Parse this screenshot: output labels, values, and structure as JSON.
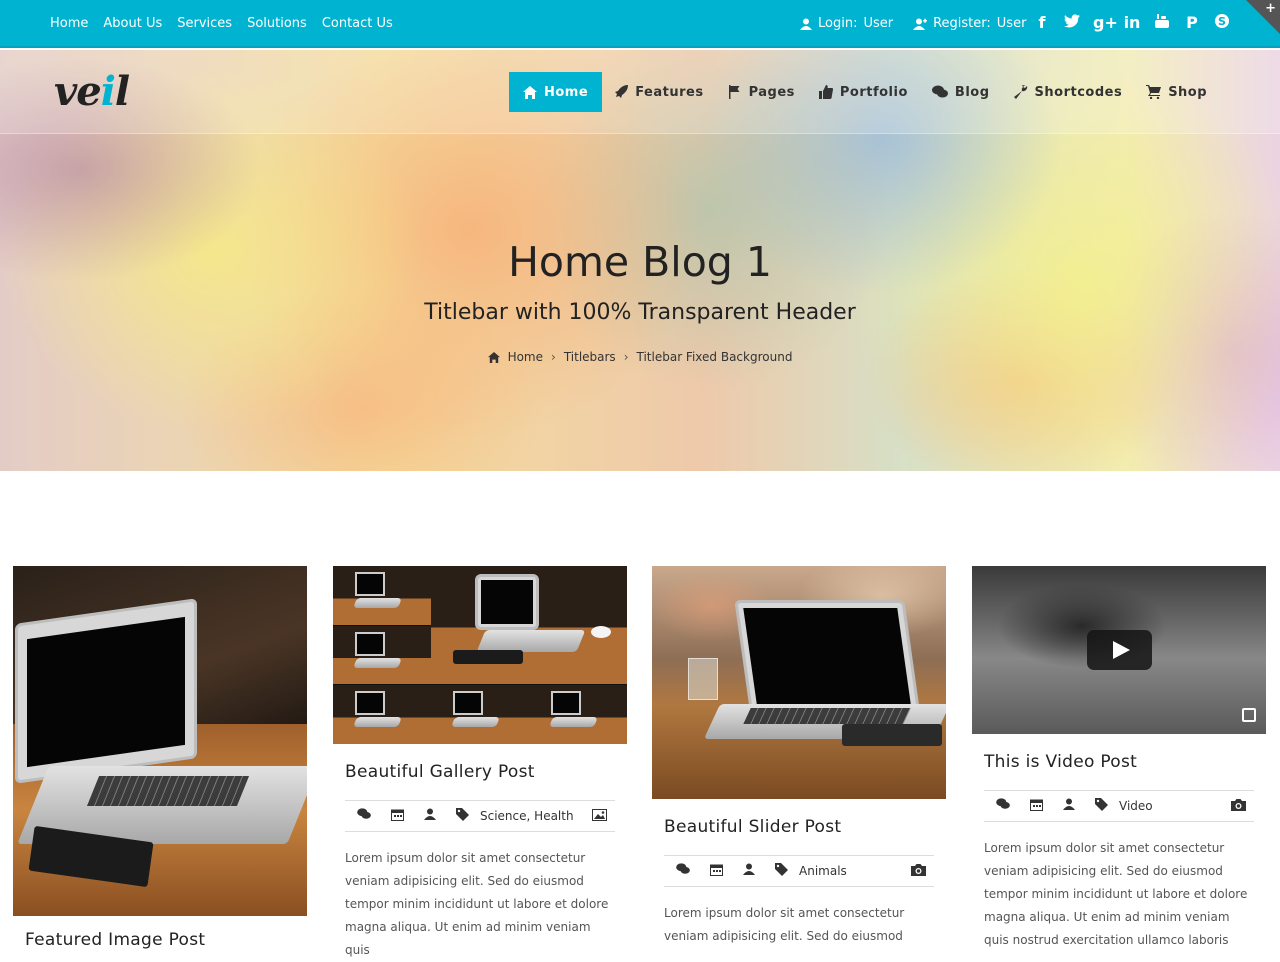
{
  "topbar": {
    "links": [
      "Home",
      "About Us",
      "Services",
      "Solutions",
      "Contact Us"
    ],
    "login_label": "Login:",
    "login_user": "User",
    "register_label": "Register:",
    "register_user": "User",
    "social_icons": [
      "facebook-icon",
      "twitter-icon",
      "google-plus-icon",
      "linkedin-icon",
      "youtube-icon",
      "pinterest-icon",
      "skype-icon"
    ],
    "accent": "#00b3d1"
  },
  "logo": {
    "text_a": "ve",
    "text_i": "i",
    "text_b": "l"
  },
  "nav": {
    "items": [
      {
        "label": "Home",
        "icon": "home-icon",
        "active": true
      },
      {
        "label": "Features",
        "icon": "rocket-icon"
      },
      {
        "label": "Pages",
        "icon": "flag-icon"
      },
      {
        "label": "Portfolio",
        "icon": "thumbs-up-icon"
      },
      {
        "label": "Blog",
        "icon": "comments-icon"
      },
      {
        "label": "Shortcodes",
        "icon": "wrench-icon"
      },
      {
        "label": "Shop",
        "icon": "cart-icon"
      }
    ]
  },
  "hero": {
    "title": "Home Blog 1",
    "subtitle": "Titlebar with 100% Transparent Header",
    "breadcrumb": [
      "Home",
      "Titlebars",
      "Titlebar Fixed Background"
    ]
  },
  "posts": [
    {
      "title": "Featured Image Post",
      "tags": "",
      "text": ""
    },
    {
      "title": "Beautiful Gallery Post",
      "tags": [
        "Science",
        "Health"
      ],
      "text": "Lorem ipsum dolor sit amet consectetur veniam adipisicing elit. Sed do eiusmod tempor minim incididunt ut labore et dolore magna aliqua. Ut enim ad minim veniam quis"
    },
    {
      "title": "Beautiful Slider Post",
      "tags": [
        "Animals"
      ],
      "text": "Lorem ipsum dolor sit amet consectetur veniam adipisicing elit. Sed do eiusmod"
    },
    {
      "title": "This is Video Post",
      "tags": [
        "Video"
      ],
      "text": "Lorem ipsum dolor sit amet consectetur veniam adipisicing elit. Sed do eiusmod tempor minim incididunt ut labore et dolore magna aliqua. Ut enim ad minim veniam quis nostrud exercitation ullamco laboris"
    }
  ]
}
